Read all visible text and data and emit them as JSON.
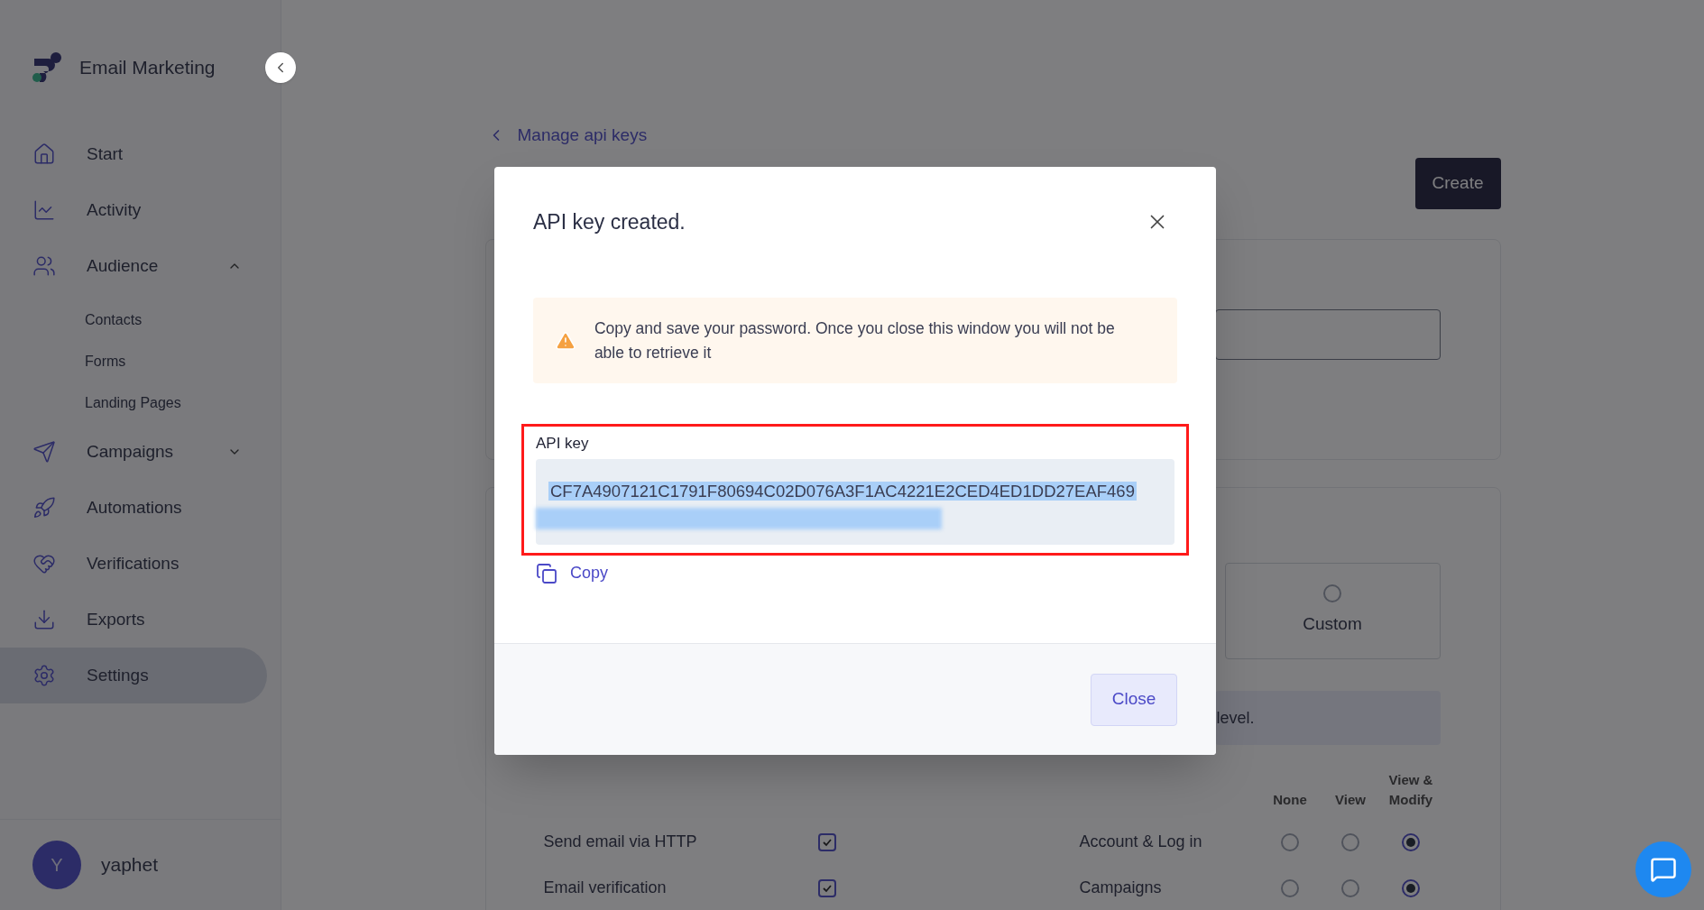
{
  "sidebar": {
    "brand": "Email Marketing",
    "items": [
      {
        "label": "Start",
        "selected": false
      },
      {
        "label": "Activity",
        "selected": false
      },
      {
        "label": "Audience",
        "selected": false,
        "expanded": true,
        "children": [
          {
            "label": "Contacts",
            "selected": false
          },
          {
            "label": "Forms",
            "selected": false
          },
          {
            "label": "Landing Pages",
            "selected": false
          }
        ]
      },
      {
        "label": "Campaigns",
        "selected": false,
        "expanded": false
      },
      {
        "label": "Automations",
        "selected": false
      },
      {
        "label": "Verifications",
        "selected": false
      },
      {
        "label": "Exports",
        "selected": false
      },
      {
        "label": "Settings",
        "selected": true
      }
    ],
    "user": {
      "initial": "Y",
      "name": "yaphet"
    }
  },
  "page": {
    "back_link": "Manage api keys",
    "create_button": "Create",
    "access_option": {
      "label": "Custom",
      "selected": false
    },
    "notice_fragment": "level.",
    "permission_columns": [
      "None",
      "View",
      "View & Modify"
    ],
    "features": [
      {
        "label": "Send email via HTTP",
        "checked": true
      },
      {
        "label": "Email verification",
        "checked": true
      }
    ],
    "permissions": [
      {
        "label": "Account & Log in",
        "options": [
          {
            "selected": false
          },
          {
            "selected": false
          },
          {
            "selected": true
          }
        ]
      },
      {
        "label": "Campaigns",
        "options": [
          {
            "selected": false
          },
          {
            "selected": false
          },
          {
            "selected": true
          }
        ]
      }
    ]
  },
  "dialog": {
    "title": "API key created.",
    "warning": "Copy and save your password. Once you close this window you will not be able to retrieve it",
    "api_key": {
      "label": "API key",
      "value": "CF7A4907121C1791F80694C02D076A3F1AC4221E2CED4ED1DD27EAF469",
      "selected": true,
      "highlighted": true
    },
    "copy_link": "Copy",
    "close_button": "Close"
  }
}
